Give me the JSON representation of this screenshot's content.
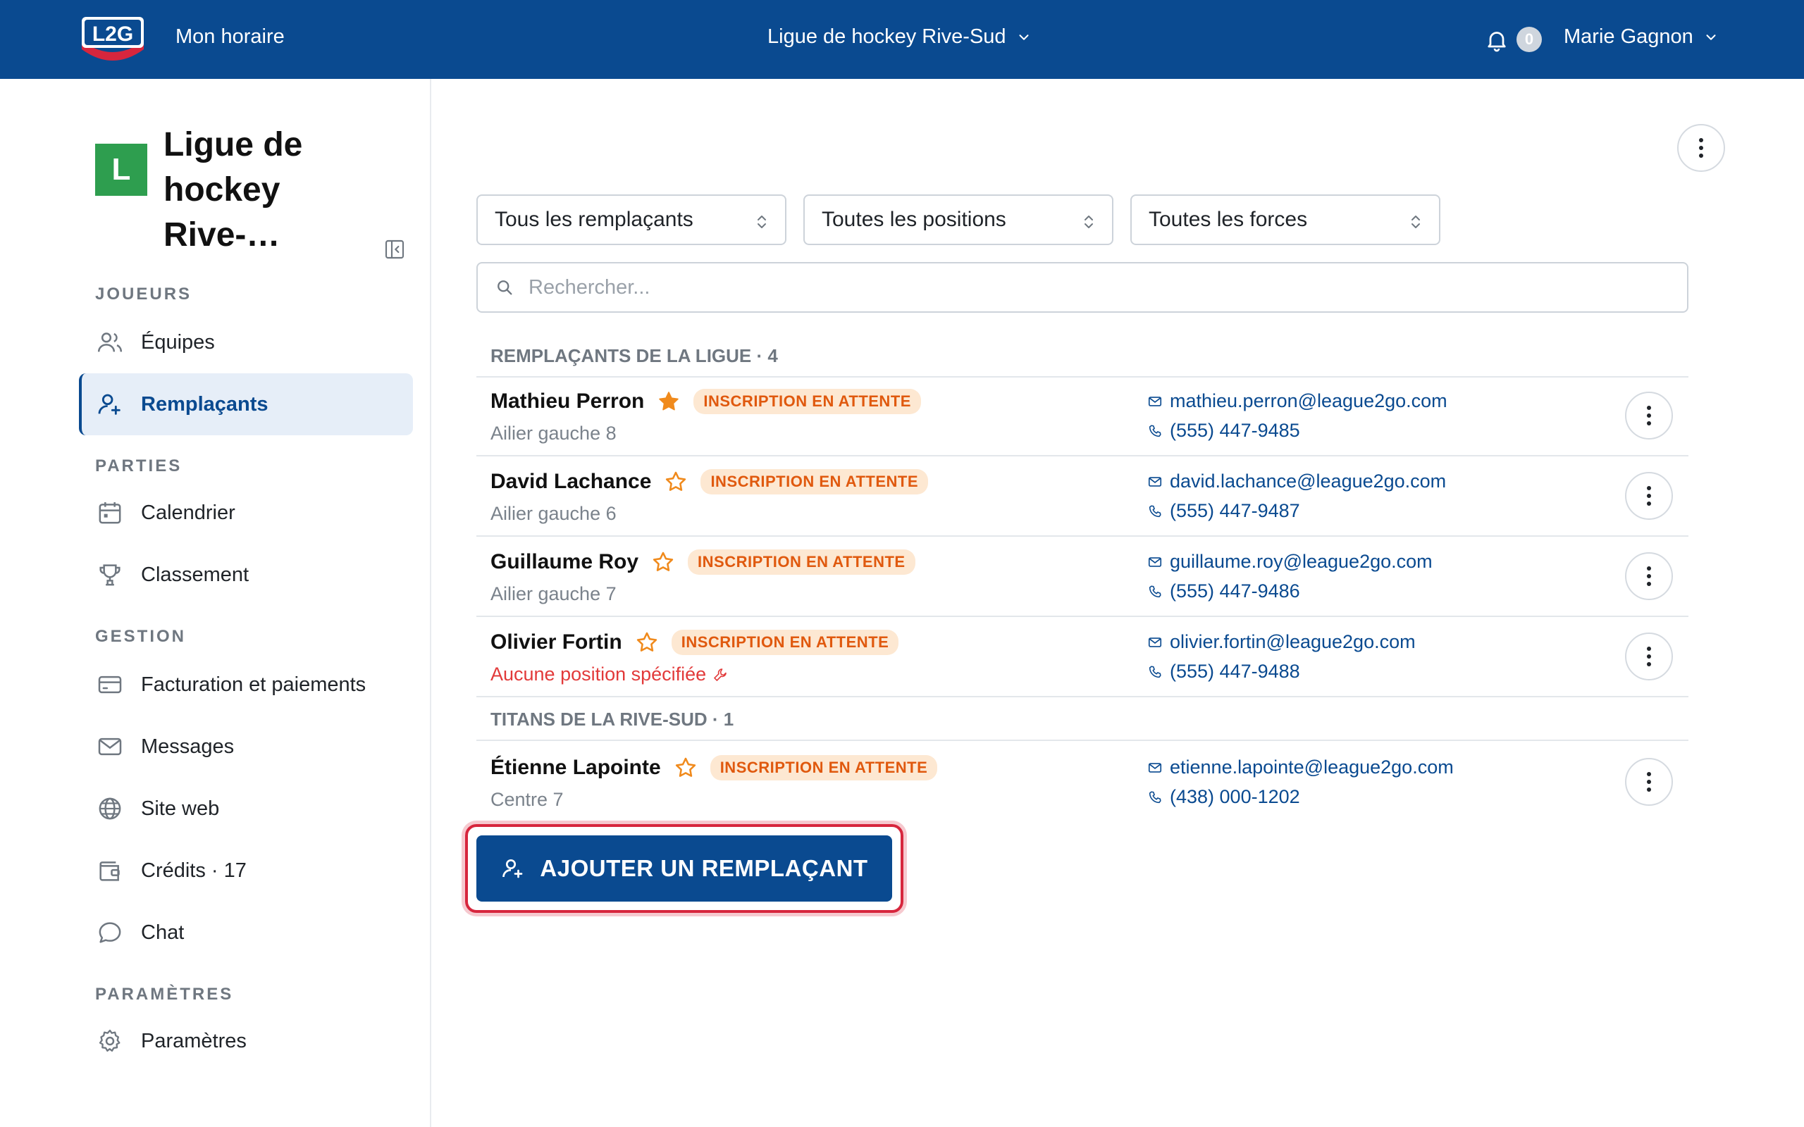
{
  "topbar": {
    "logo_text": "L2G",
    "my_schedule": "Mon horaire",
    "league_switcher": "Ligue de hockey Rive-Sud",
    "notification_count": "0",
    "user_name": "Marie Gagnon"
  },
  "sidebar": {
    "org_initial": "L",
    "org_name": "Ligue de hockey Rive-…",
    "sections": {
      "players": "JOUEURS",
      "games": "PARTIES",
      "management": "GESTION",
      "settings": "PARAMÈTRES"
    },
    "items": {
      "teams": "Équipes",
      "substitutes": "Remplaçants",
      "calendar": "Calendrier",
      "standings": "Classement",
      "billing": "Facturation et paiements",
      "messages": "Messages",
      "website": "Site web",
      "credits": "Crédits · 17",
      "chat": "Chat",
      "settings": "Paramètres"
    },
    "active_item": "substitutes"
  },
  "filters": {
    "substitutes": "Tous les remplaçants",
    "positions": "Toutes les positions",
    "strengths": "Toutes les forces"
  },
  "search": {
    "placeholder": "Rechercher..."
  },
  "groups": [
    {
      "header": "REMPLAÇANTS DE LA LIGUE · 4",
      "rows": [
        {
          "name": "Mathieu Perron",
          "favorite": true,
          "badge": "INSCRIPTION EN ATTENTE",
          "position": "Ailier gauche 8",
          "email": "mathieu.perron@league2go.com",
          "phone": "(555) 447-9485"
        },
        {
          "name": "David Lachance",
          "favorite": false,
          "badge": "INSCRIPTION EN ATTENTE",
          "position": "Ailier gauche 6",
          "email": "david.lachance@league2go.com",
          "phone": "(555) 447-9487"
        },
        {
          "name": "Guillaume Roy",
          "favorite": false,
          "badge": "INSCRIPTION EN ATTENTE",
          "position": "Ailier gauche 7",
          "email": "guillaume.roy@league2go.com",
          "phone": "(555) 447-9486"
        },
        {
          "name": "Olivier Fortin",
          "favorite": false,
          "badge": "INSCRIPTION EN ATTENTE",
          "position": "Aucune position spécifiée",
          "email": "olivier.fortin@league2go.com",
          "phone": "(555) 447-9488"
        }
      ]
    },
    {
      "header": "TITANS DE LA RIVE-SUD · 1",
      "rows": [
        {
          "name": "Étienne Lapointe",
          "favorite": false,
          "badge": "INSCRIPTION EN ATTENTE",
          "position": "Centre 7",
          "email": "etienne.lapointe@league2go.com",
          "phone": "(438) 000-1202"
        }
      ]
    }
  ],
  "add_button": "AJOUTER UN REMPLAÇANT",
  "colors": {
    "brand": "#0a4a90",
    "badge_bg": "#fde8d2",
    "badge_text": "#e0590e",
    "favorite_star": "#f08a1c",
    "warning": "#e23a3a",
    "highlight": "#d7263d"
  }
}
